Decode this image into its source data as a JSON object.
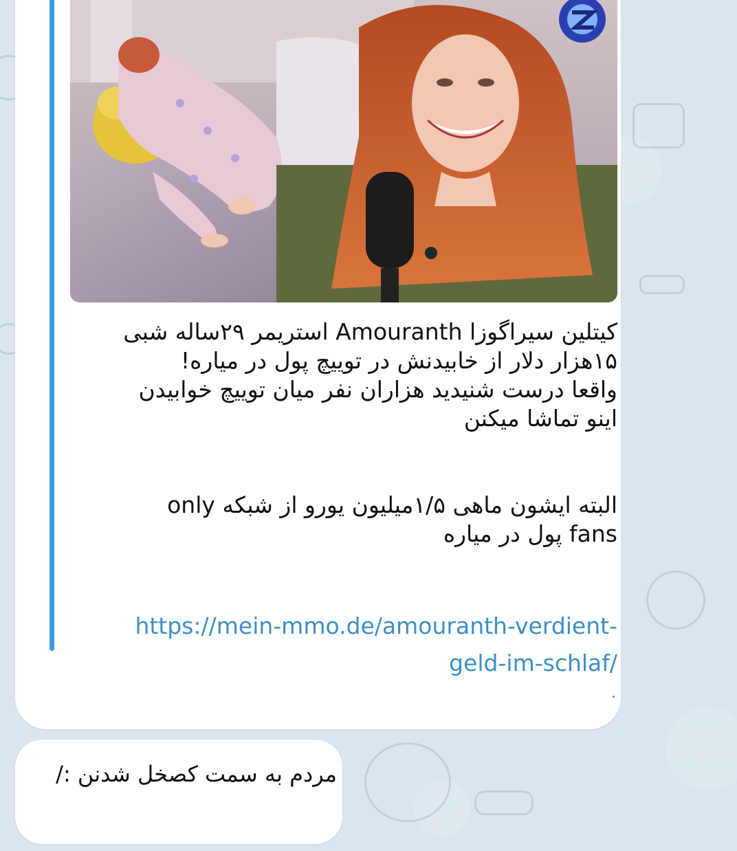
{
  "post": {
    "lines": [
      "کیتلین   سیراگوزا Amouranth استریمر ۲۹ساله  شبی",
      "۱۵هزار دلار از خابیدنش  در توییچ پول در میاره!",
      "واقعا درست شنیدید هزاران نفر  میان توییچ خوابیدن",
      "اینو تماشا میکنن"
    ],
    "lines2": [
      "البته ایشون ماهی ۱/۵میلیون یورو از شبکه only",
      "fans پول در میاره"
    ],
    "link_line1": "https://mein-mmo.de/amouranth-verdient-",
    "link_line2": "geld-im-schlaf/"
  },
  "reply": {
    "text": "مردم به سمت کصخل شدنن :/"
  }
}
